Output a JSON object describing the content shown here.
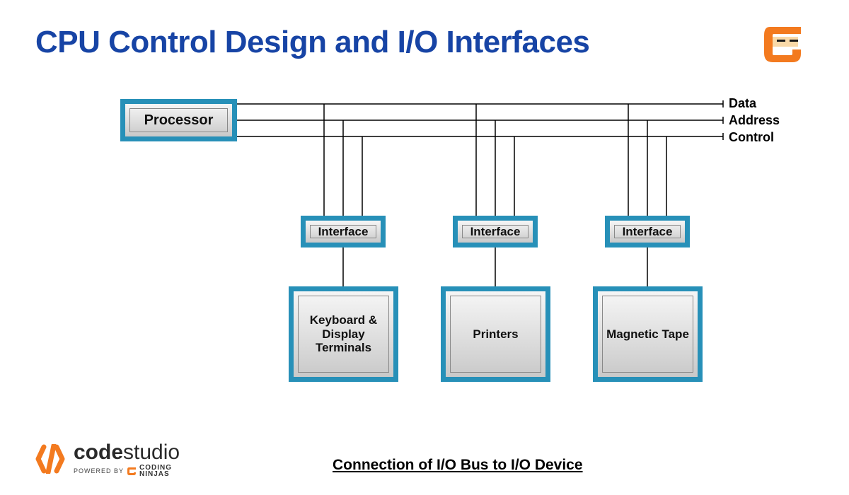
{
  "title": "CPU Control Design and I/O Interfaces",
  "diagram": {
    "processor": "Processor",
    "bus_labels": {
      "data": "Data",
      "address": "Address",
      "control": "Control"
    },
    "interfaces": [
      "Interface",
      "Interface",
      "Interface"
    ],
    "devices": [
      "Keyboard & Display Terminals",
      "Printers",
      "Magnetic Tape"
    ]
  },
  "caption": "Connection of I/O Bus to I/O Device",
  "footer": {
    "brand_bold": "code",
    "brand_light": "studio",
    "powered": "POWERED BY",
    "ninjas1": "CODING",
    "ninjas2": "NINJAS"
  }
}
